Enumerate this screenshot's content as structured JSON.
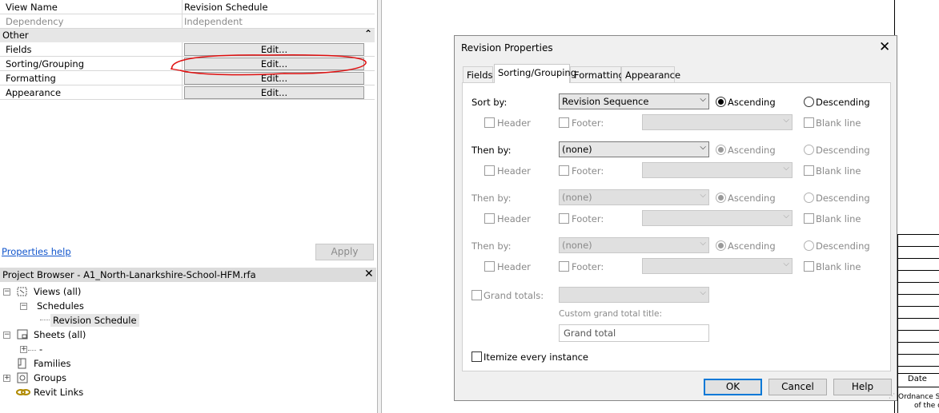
{
  "properties": {
    "rows": [
      {
        "name": "View Name",
        "value": "Revision Schedule"
      },
      {
        "name": "Dependency",
        "value": "Independent"
      }
    ],
    "group_other": {
      "label": "Other",
      "collapse_glyph": "⌃"
    },
    "edit_rows": [
      {
        "name": "Fields",
        "button": "Edit..."
      },
      {
        "name": "Sorting/Grouping",
        "button": "Edit..."
      },
      {
        "name": "Formatting",
        "button": "Edit..."
      },
      {
        "name": "Appearance",
        "button": "Edit..."
      }
    ],
    "help_link": "Properties help",
    "apply_button": "Apply",
    "annotation_color": "#e01010"
  },
  "project_browser": {
    "title": "Project Browser - A1_North-Lanarkshire-School-HFM.rfa",
    "close": "✕",
    "tree": {
      "views": "Views (all)",
      "schedules": "Schedules",
      "revision_schedule": "Revision Schedule",
      "sheets": "Sheets (all)",
      "sheet_dash": "-",
      "families": "Families",
      "groups": "Groups",
      "revit_links": "Revit Links"
    }
  },
  "titleblock": {
    "date_label": "Date",
    "ordnance_line1": "Ordnance S",
    "ordnance_line2": "of the c"
  },
  "dialog": {
    "title": "Revision Properties",
    "close": "✕",
    "tabs": [
      "Fields",
      "Sorting/Grouping",
      "Formatting",
      "Appearance"
    ],
    "active_tab": "Sorting/Grouping",
    "sort_rows": [
      {
        "label": "Sort by:",
        "value": "Revision Sequence",
        "ascending": "Ascending",
        "descending": "Descending",
        "header": "Header",
        "footer": "Footer:",
        "blank_line": "Blank line"
      },
      {
        "label": "Then by:",
        "value": "(none)",
        "ascending": "Ascending",
        "descending": "Descending",
        "header": "Header",
        "footer": "Footer:",
        "blank_line": "Blank line"
      },
      {
        "label": "Then by:",
        "value": "(none)",
        "ascending": "Ascending",
        "descending": "Descending",
        "header": "Header",
        "footer": "Footer:",
        "blank_line": "Blank line"
      },
      {
        "label": "Then by:",
        "value": "(none)",
        "ascending": "Ascending",
        "descending": "Descending",
        "header": "Header",
        "footer": "Footer:",
        "blank_line": "Blank line"
      }
    ],
    "grand_totals_label": "Grand totals:",
    "custom_title_label": "Custom grand total title:",
    "grand_total_value": "Grand total",
    "itemize_label": "Itemize every instance",
    "ok_button": "OK",
    "cancel_button": "Cancel",
    "help_button": "Help",
    "accent_color": "#0078d7"
  }
}
